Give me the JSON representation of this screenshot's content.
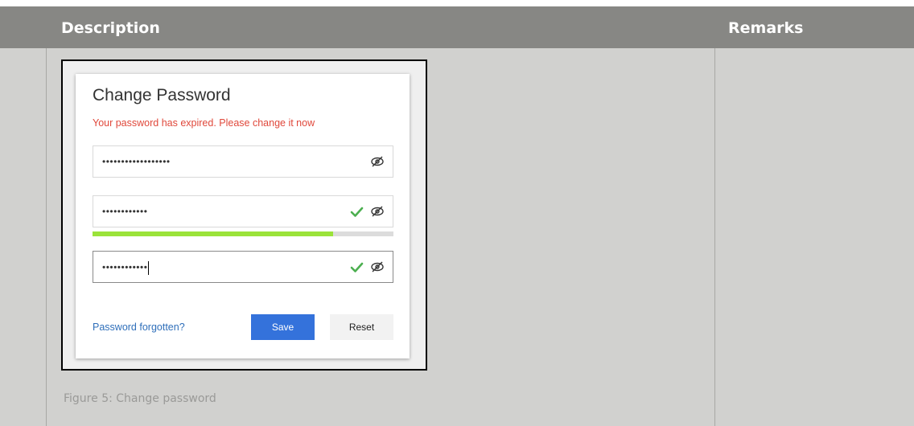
{
  "table": {
    "header": {
      "description": "Description",
      "remarks": "Remarks"
    },
    "caption": "Figure 5: Change password"
  },
  "dialog": {
    "title": "Change Password",
    "message": "Your password has expired. Please change it now",
    "fields": [
      {
        "masked_value": "••••••••••••••••••",
        "valid": false
      },
      {
        "masked_value": "••••••••••••",
        "valid": true
      },
      {
        "masked_value": "••••••••••••",
        "valid": true
      }
    ],
    "strength_fraction": 0.8,
    "forgot_link": "Password forgotten?",
    "save_label": "Save",
    "reset_label": "Reset"
  },
  "colors": {
    "header_bg": "#878784",
    "body_bg": "#d1d1cf",
    "error_text": "#e0483b",
    "link": "#2f6fba",
    "save_button": "#3472db",
    "strength_fill": "#9be33a",
    "check": "#4caf50"
  },
  "icons": [
    "eye-slash-icon",
    "check-icon"
  ]
}
